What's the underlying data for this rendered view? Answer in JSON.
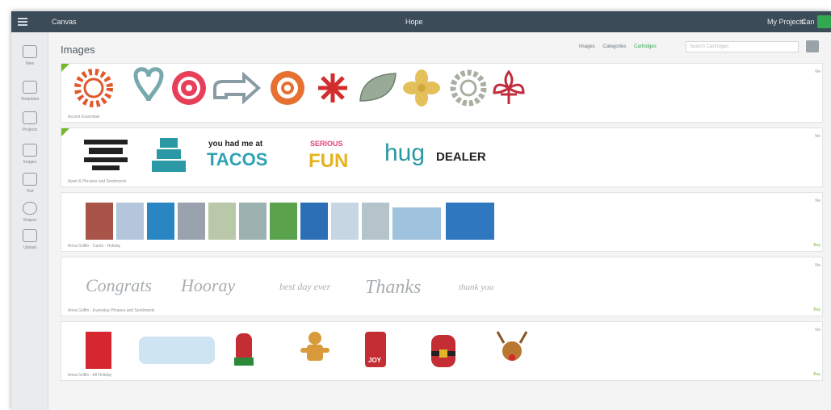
{
  "topbar": {
    "app": "Canvas",
    "title": "Hope",
    "project": "My Projects",
    "cancel": "Can"
  },
  "sidebar": {
    "items": [
      {
        "label": "New",
        "icon": "new-icon"
      },
      {
        "label": "Templates",
        "icon": "shirt-icon"
      },
      {
        "label": "Projects",
        "icon": "projects-icon"
      },
      {
        "label": "Images",
        "icon": "images-icon"
      },
      {
        "label": "Text",
        "icon": "text-icon"
      },
      {
        "label": "Shapes",
        "icon": "shapes-icon"
      },
      {
        "label": "Upload",
        "icon": "upload-icon"
      }
    ]
  },
  "main": {
    "title": "Images",
    "tabs": [
      "Images",
      "Categories",
      "Cartridges"
    ],
    "active_tab": "Cartridges",
    "search_placeholder": "Search Cartridges"
  },
  "rows": [
    {
      "label": "Accent Essentials",
      "right": "Vie",
      "buy": ""
    },
    {
      "label": "Apart & Phrases and Sentiments",
      "right": "Vie",
      "buy": ""
    },
    {
      "label": "Anna Griffin - Cards - Holiday",
      "right": "Vie",
      "buy": "Buy"
    },
    {
      "label": "Anna Griffin - Everyday Phrases and Sentiments",
      "right": "Vie",
      "buy": "Buy"
    },
    {
      "label": "Anna Griffin - All Holiday",
      "right": "Vie",
      "buy": "Buy"
    }
  ],
  "row1_text": {
    "a": "you had me at",
    "b": "TACOS",
    "c": "SERIOUS",
    "d": "FUN",
    "e": "hug",
    "f": "DEALER"
  },
  "row3_text": {
    "a": "Congrats",
    "b": "Hooray",
    "c": "best day ever",
    "d": "Thanks",
    "e": "thank you"
  },
  "row4_text": {
    "a": "JOY"
  },
  "colors": {
    "brand": "#33a852",
    "flag": "#76b72a",
    "topbar": "#3c4b58"
  }
}
